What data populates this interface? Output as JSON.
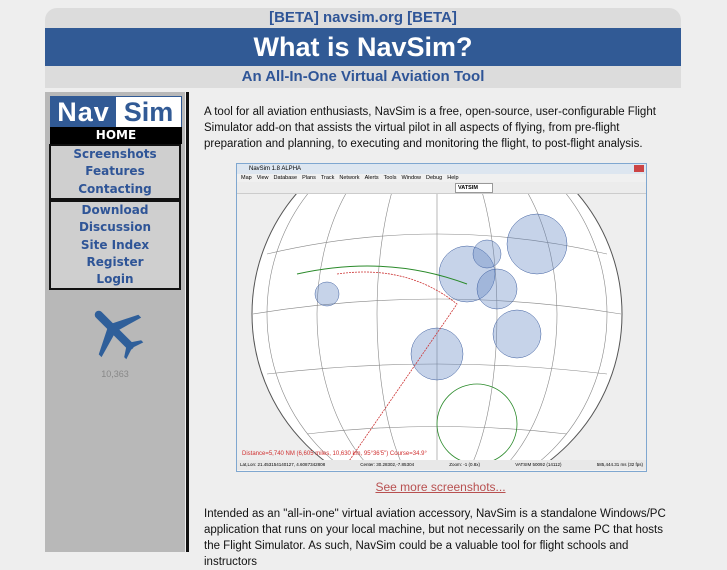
{
  "header": {
    "beta_title": "[BETA] navsim.org [BETA]",
    "title": "What is NavSim?",
    "subtitle": "An All-In-One Virtual Aviation Tool"
  },
  "sidebar": {
    "logo_left": "Nav",
    "logo_right": "Sim",
    "home": "HOME",
    "group1": [
      "Screenshots",
      "Features",
      "Contacting"
    ],
    "group2": [
      "Download",
      "Discussion",
      "Site Index",
      "Register",
      "Login"
    ],
    "counter": "10,363"
  },
  "main": {
    "intro": "A tool for all aviation enthusiasts, NavSim is a free, open-source, user-configurable Flight Simulator add-on that assists the virtual pilot in all aspects of flying, from pre-flight preparation and planning, to executing and monitoring the flight, to post-flight analysis.",
    "screenshot": {
      "window_title": "NavSim 1.8 ALPHA",
      "menu": [
        "Map",
        "View",
        "Database",
        "Plans",
        "Track",
        "Network",
        "Alerts",
        "Tools",
        "Window",
        "Debug",
        "Help"
      ],
      "network_select": "VATSIM",
      "distance": "Distance=5,740 NM (6,605 miles, 10,630 km, 95°36'5\")  Course=34.9°",
      "status": [
        "Lat,Lon: 21.453154140127, 4.6087342808",
        "Center: 30.28302,-7.85304",
        "Zoom: -1 (0.8x)",
        "VATSIM 50092 (14112)",
        "585,444.31 ms (32 fps)"
      ]
    },
    "more_link": "See more screenshots...",
    "para2": "Intended as an \"all-in-one\" virtual aviation accessory, NavSim is a standalone Windows/PC application that runs on your local machine, but not necessarily on the same PC that hosts the Flight Simulator. As such, NavSim could be a valuable tool for flight schools and instructors"
  }
}
